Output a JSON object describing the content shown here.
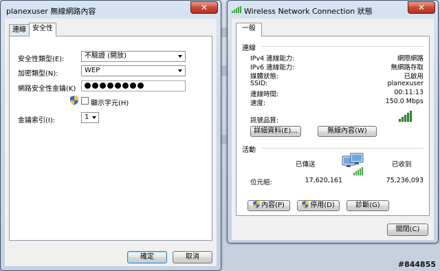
{
  "window1": {
    "title": "planexuser 無線網路內容",
    "close": "✕",
    "tabs": [
      {
        "label": "連線",
        "active": false
      },
      {
        "label": "安全性",
        "active": true
      }
    ],
    "security_type_label": "安全性類型(E):",
    "security_type_value": "不驗證 (開放)",
    "encryption_type_label": "加密類型(N):",
    "encryption_type_value": "WEP",
    "key_label": "網路安全性金鑰(K)",
    "key_masked_count": 8,
    "show_chars_label": "顯示字元(H)",
    "key_index_label": "金鑰索引(I):",
    "key_index_value": "1",
    "ok": "確定",
    "cancel": "取消"
  },
  "window2": {
    "title": "Wireless Network Connection 狀態",
    "close": "✕",
    "tab": "一般",
    "connection_head": "連線",
    "rows": [
      {
        "label": "IPv4 連線能力:",
        "value": "網際網路"
      },
      {
        "label": "IPv6 連線能力:",
        "value": "無網路存取"
      },
      {
        "label": "媒體狀態:",
        "value": "已啟用"
      },
      {
        "label": "SSID:",
        "value": "planexuser"
      },
      {
        "label": "連線時間:",
        "value": "00:11:13"
      },
      {
        "label": "速度:",
        "value": "150.0 Mbps"
      }
    ],
    "signal_label": "訊號品質:",
    "signal_level": 5,
    "details_button": "詳細資料(E)...",
    "wireless_props_button": "無線內容(W)",
    "activity_head": "活動",
    "sent_label": "已傳送",
    "received_label": "已收到",
    "bytes_label": "位元組:",
    "bytes_sent": "17,620,161",
    "bytes_received": "75,236,093",
    "properties_button": "內容(P)",
    "disable_button": "停用(D)",
    "diagnose_button": "診斷(G)",
    "close_button": "關閉(C)"
  },
  "watermark": "#844855"
}
